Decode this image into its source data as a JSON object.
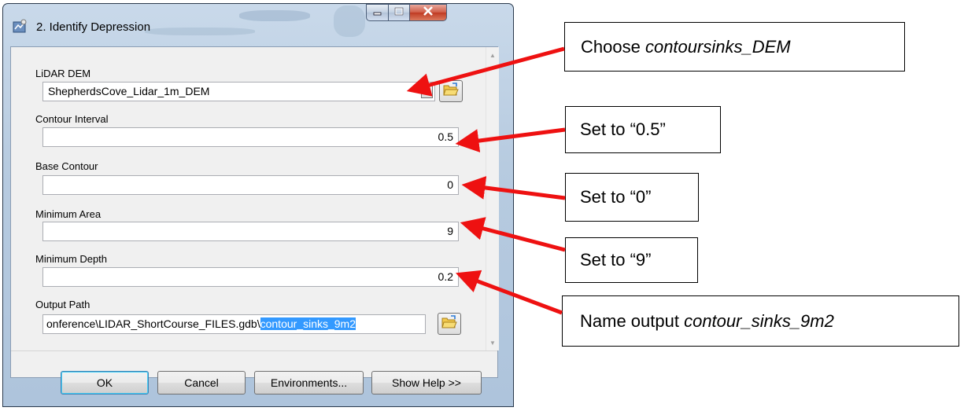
{
  "window": {
    "title": "2. Identify Depression"
  },
  "fields": {
    "lidar_dem": {
      "label": "LiDAR DEM",
      "value": "ShepherdsCove_Lidar_1m_DEM"
    },
    "contour_interval": {
      "label": "Contour Interval",
      "value": "0.5"
    },
    "base_contour": {
      "label": "Base Contour",
      "value": "0"
    },
    "minimum_area": {
      "label": "Minimum Area",
      "value": "9"
    },
    "minimum_depth": {
      "label": "Minimum Depth",
      "value": "0.2"
    },
    "output_path": {
      "label": "Output Path",
      "value_prefix": "onference\\LIDAR_ShortCourse_FILES.gdb\\",
      "value_selected": "contour_sinks_9m2"
    }
  },
  "buttons": {
    "ok": "OK",
    "cancel": "Cancel",
    "environments": "Environments...",
    "show_help": "Show Help >>"
  },
  "callouts": {
    "dem": {
      "prefix": "Choose ",
      "italic": "contoursinks_DEM"
    },
    "interval": {
      "text": "Set to “0.5”"
    },
    "base": {
      "text": "Set to “0”"
    },
    "area": {
      "text": "Set to “9”"
    },
    "output": {
      "prefix": "Name output ",
      "italic": "contour_sinks_9m2"
    }
  },
  "icons": [
    "app-tool-icon",
    "minimize-icon",
    "maximize-icon",
    "close-icon",
    "folder-open-icon",
    "dropdown-arrow-icon",
    "scroll-up-icon",
    "scroll-down-icon"
  ],
  "colors": {
    "arrow": "#ee1111",
    "selection": "#3399ff",
    "close_button": "#c9432b"
  }
}
